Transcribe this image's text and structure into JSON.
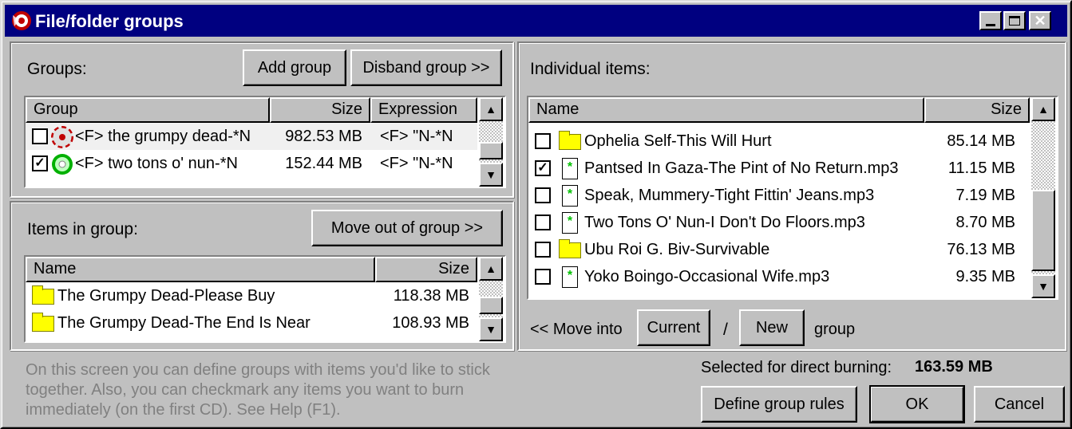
{
  "window": {
    "title": "File/folder groups"
  },
  "groups": {
    "label": "Groups:",
    "add_button": "Add group",
    "disband_button": "Disband group >>",
    "columns": [
      "Group",
      "Size",
      "Expression"
    ],
    "rows": [
      {
        "checked": false,
        "name": "<F> the grumpy dead-*N",
        "size": "982.53 MB",
        "expression": "<F> \"N-*N",
        "icon": "disc-red-icon"
      },
      {
        "checked": true,
        "name": "<F> two tons o' nun-*N",
        "size": "152.44 MB",
        "expression": "<F> \"N-*N",
        "icon": "disc-green-icon"
      }
    ]
  },
  "items_in_group": {
    "label": "Items in group:",
    "move_out_button": "Move out of group >>",
    "columns": [
      "Name",
      "Size"
    ],
    "rows": [
      {
        "name": "The Grumpy Dead-Please Buy",
        "size": "118.38 MB",
        "icon": "folder-icon"
      },
      {
        "name": "The Grumpy Dead-The End Is Near",
        "size": "108.93 MB",
        "icon": "folder-icon"
      }
    ]
  },
  "individual": {
    "label": "Individual items:",
    "columns": [
      "Name",
      "Size"
    ],
    "rows": [
      {
        "checked": false,
        "type": "folder",
        "name": "Ophelia Self-This Will Hurt",
        "size": "85.14 MB"
      },
      {
        "checked": true,
        "type": "file",
        "name": "Pantsed In Gaza-The Pint of No Return.mp3",
        "size": "11.15 MB"
      },
      {
        "checked": false,
        "type": "file",
        "name": "Speak, Mummery-Tight Fittin' Jeans.mp3",
        "size": "7.19 MB"
      },
      {
        "checked": false,
        "type": "file",
        "name": "Two Tons O' Nun-I Don't Do Floors.mp3",
        "size": "8.70 MB"
      },
      {
        "checked": false,
        "type": "folder",
        "name": "Ubu Roi G. Biv-Survivable",
        "size": "76.13 MB"
      },
      {
        "checked": false,
        "type": "file",
        "name": "Yoko Boingo-Occasional Wife.mp3",
        "size": "9.35 MB"
      }
    ],
    "move_into_label": "<< Move into",
    "current_button": "Current",
    "slash": "/",
    "new_button": "New",
    "group_label": "group"
  },
  "hint_text": "On this screen you can define groups with items you'd like to stick together. Also, you can checkmark any items you want to burn immediately (on the first CD). See Help (F1).",
  "selected_label": "Selected for direct burning:",
  "selected_value": "163.59 MB",
  "buttons": {
    "define_rules": "Define group rules",
    "ok": "OK",
    "cancel": "Cancel"
  }
}
